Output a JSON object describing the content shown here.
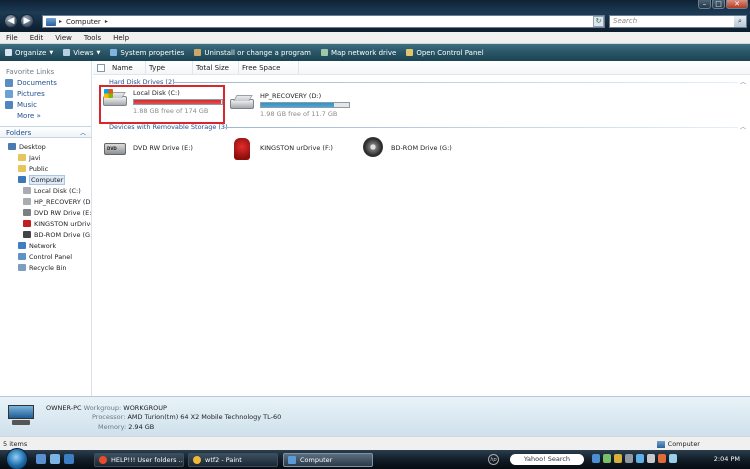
{
  "address": {
    "path": "Computer",
    "arrow": "▸"
  },
  "search": {
    "placeholder": "Search"
  },
  "window_buttons": {
    "min": "–",
    "max": "□",
    "close": "✕"
  },
  "menu": [
    "File",
    "Edit",
    "View",
    "Tools",
    "Help"
  ],
  "toolbar": [
    {
      "label": "Organize",
      "icon": "organize-icon",
      "dropdown": true,
      "color": "#d9e4ee"
    },
    {
      "label": "Views",
      "icon": "views-icon",
      "dropdown": true,
      "color": "#b8cfe2"
    },
    {
      "label": "System properties",
      "icon": "system-properties-icon",
      "dropdown": false,
      "color": "#7fb3e0"
    },
    {
      "label": "Uninstall or change a program",
      "icon": "uninstall-icon",
      "dropdown": false,
      "color": "#c9a86a"
    },
    {
      "label": "Map network drive",
      "icon": "network-drive-icon",
      "dropdown": false,
      "color": "#9ec7a5"
    },
    {
      "label": "Open Control Panel",
      "icon": "control-panel-icon",
      "dropdown": false,
      "color": "#e3c46e"
    }
  ],
  "nav": {
    "favorites_header": "Favorite Links",
    "favorites": [
      {
        "label": "Documents",
        "icon": "documents-icon",
        "color": "#5b8cc4"
      },
      {
        "label": "Pictures",
        "icon": "pictures-icon",
        "color": "#6aa2d6"
      },
      {
        "label": "Music",
        "icon": "music-icon",
        "color": "#4f86c0"
      }
    ],
    "more": "More  »",
    "folders_header": "Folders",
    "folders_arrow": "︿",
    "tree": [
      {
        "label": "Desktop",
        "indent": 0,
        "icon": "desktop-icon",
        "color": "#4a7bb0"
      },
      {
        "label": "Javi",
        "indent": 1,
        "icon": "user-folder-icon",
        "color": "#e7c45c"
      },
      {
        "label": "Public",
        "indent": 1,
        "icon": "folder-icon",
        "color": "#e7c45c"
      },
      {
        "label": "Computer",
        "indent": 1,
        "icon": "computer-icon",
        "color": "#3c78b8",
        "selected": true
      },
      {
        "label": "Local Disk (C:)",
        "indent": 2,
        "icon": "hard-disk-icon",
        "color": "#a9adb1"
      },
      {
        "label": "HP_RECOVERY (D:)",
        "indent": 2,
        "icon": "hard-disk-icon",
        "color": "#a9adb1"
      },
      {
        "label": "DVD RW Drive (E:)",
        "indent": 2,
        "icon": "dvd-drive-icon",
        "color": "#7c8084"
      },
      {
        "label": "KINGSTON urDrive",
        "indent": 2,
        "icon": "usb-drive-icon",
        "color": "#c11f1f"
      },
      {
        "label": "BD-ROM Drive (G:)",
        "indent": 2,
        "icon": "bd-drive-icon",
        "color": "#444"
      },
      {
        "label": "Network",
        "indent": 1,
        "icon": "network-icon",
        "color": "#3f7fbf"
      },
      {
        "label": "Control Panel",
        "indent": 1,
        "icon": "control-panel-icon",
        "color": "#5f93c8"
      },
      {
        "label": "Recycle Bin",
        "indent": 1,
        "icon": "recycle-bin-icon",
        "color": "#7d9fbf"
      }
    ]
  },
  "columns": [
    "Name",
    "Type",
    "Total Size",
    "Free Space"
  ],
  "groups": {
    "hard": "Hard Disk Drives (2)",
    "removable": "Devices with Removable Storage (3)",
    "arrow": "︿"
  },
  "drives": {
    "c": {
      "name": "Local Disk (C:)",
      "free": "1.88 GB free of 174 GB",
      "used_fraction": 0.99,
      "bar_color": "#d92b2b"
    },
    "d": {
      "name": "HP_RECOVERY (D:)",
      "free": "1.98 GB free of 11.7 GB",
      "used_fraction": 0.83,
      "bar_color": "#2a95c9"
    }
  },
  "removable": [
    {
      "name": "DVD RW Drive (E:)",
      "icon": "dvd-drive-icon",
      "disc_label": "DVD"
    },
    {
      "name": "KINGSTON urDrive (F:)",
      "icon": "kingston-drive-icon"
    },
    {
      "name": "BD-ROM Drive (G:)",
      "icon": "bd-drive-icon"
    }
  ],
  "details": {
    "pc_name": "OWNER-PC",
    "workgroup_label": "Workgroup:",
    "workgroup": "WORKGROUP",
    "processor_label": "Processor:",
    "processor": "AMD Turion(tm) 64 X2 Mobile Technology TL-60",
    "memory_label": "Memory:",
    "memory": "2.94 GB"
  },
  "status": {
    "items": "5 items",
    "location": "Computer"
  },
  "taskbar": {
    "tasks": [
      {
        "label": "HELP!!! User folders ...",
        "color": "#e84b2b"
      },
      {
        "label": "wtf2 - Paint",
        "color": "#f0b73a"
      },
      {
        "label": "Computer",
        "color": "#5a9ad6",
        "active": true
      }
    ],
    "hp": "hp",
    "yahoo": "Yahoo! Search",
    "clock": "2:04 PM"
  }
}
